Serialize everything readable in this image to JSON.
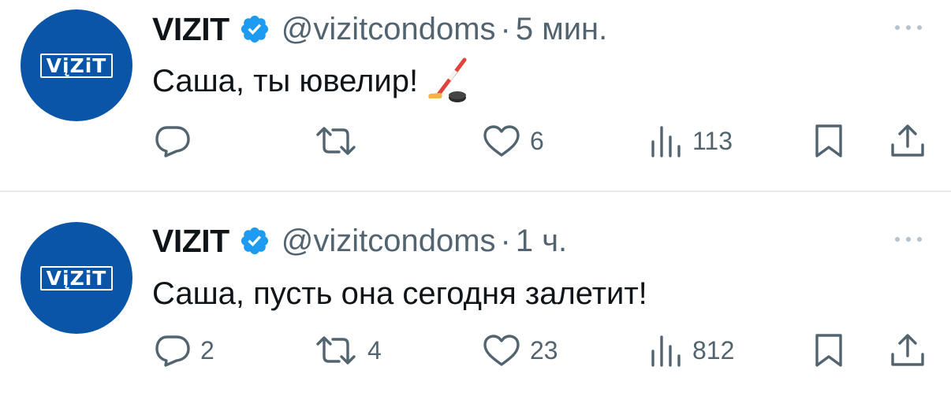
{
  "tweets": [
    {
      "account": {
        "name": "VIZIT",
        "handle": "@vizitcondoms",
        "avatar_text": "VįZiT",
        "verified": true
      },
      "time": "5 мин.",
      "text": "Саша, ты ювелир!",
      "emoji": "ice-hockey-icon",
      "stats": {
        "replies": "",
        "retweets": "",
        "likes": "6",
        "views": "113"
      }
    },
    {
      "account": {
        "name": "VIZIT",
        "handle": "@vizitcondoms",
        "avatar_text": "VįZiT",
        "verified": true
      },
      "time": "1 ч.",
      "text": "Саша, пусть она сегодня залетит!",
      "stats": {
        "replies": "2",
        "retweets": "4",
        "likes": "23",
        "views": "812"
      }
    }
  ],
  "separator": "·",
  "colors": {
    "accent": "#1d9bf0",
    "brand_blue": "#0a55a8",
    "muted": "#536471",
    "text": "#0f1419"
  },
  "icons": [
    "verified-badge-icon",
    "more-icon",
    "reply-icon",
    "retweet-icon",
    "heart-icon",
    "views-icon",
    "bookmark-icon",
    "share-icon"
  ]
}
